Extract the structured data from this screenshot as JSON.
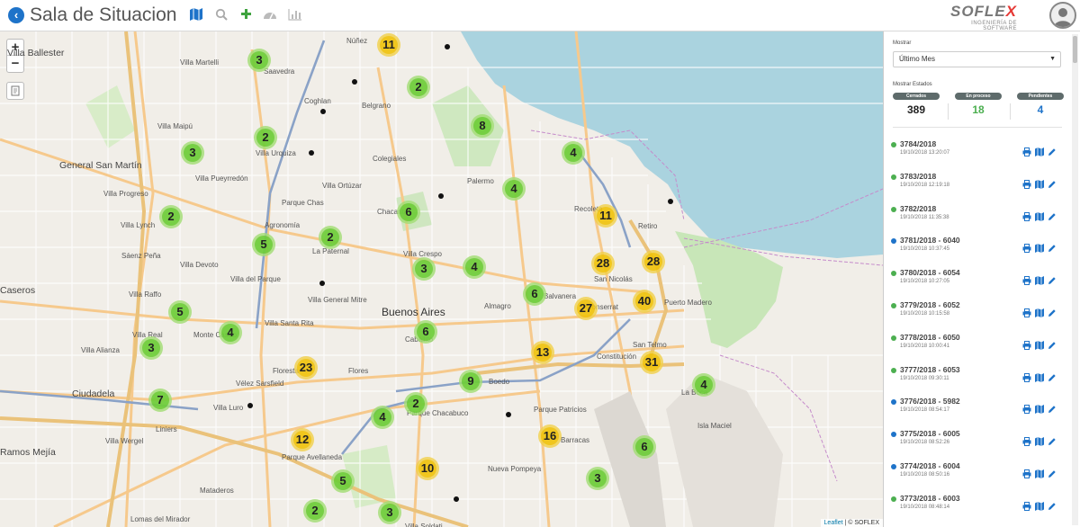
{
  "header": {
    "title": "Sala de Situacion",
    "logo_brand": "SOFLE",
    "logo_brand_x": "X",
    "logo_tagline": "INGENIERÍA DE SOFTWARE"
  },
  "map": {
    "zoom_in": "+",
    "zoom_out": "−",
    "attribution_link": "Leaflet",
    "attribution_rest": " | © SOFLEX",
    "clusters": [
      {
        "n": "11",
        "color": "yellow"
      },
      {
        "n": "3",
        "color": "green"
      },
      {
        "n": "2",
        "color": "green"
      },
      {
        "n": "8",
        "color": "green"
      },
      {
        "n": "2",
        "color": "green"
      },
      {
        "n": "3",
        "color": "green"
      },
      {
        "n": "4",
        "color": "green"
      },
      {
        "n": "4",
        "color": "green"
      },
      {
        "n": "6",
        "color": "green"
      },
      {
        "n": "11",
        "color": "yellow"
      },
      {
        "n": "2",
        "color": "green"
      },
      {
        "n": "2",
        "color": "green"
      },
      {
        "n": "5",
        "color": "green"
      },
      {
        "n": "3",
        "color": "green"
      },
      {
        "n": "4",
        "color": "green"
      },
      {
        "n": "28",
        "color": "yellow"
      },
      {
        "n": "28",
        "color": "yellow"
      },
      {
        "n": "6",
        "color": "green"
      },
      {
        "n": "40",
        "color": "yellow"
      },
      {
        "n": "27",
        "color": "yellow"
      },
      {
        "n": "5",
        "color": "green"
      },
      {
        "n": "4",
        "color": "green"
      },
      {
        "n": "3",
        "color": "green"
      },
      {
        "n": "6",
        "color": "green"
      },
      {
        "n": "13",
        "color": "yellow"
      },
      {
        "n": "23",
        "color": "yellow"
      },
      {
        "n": "31",
        "color": "yellow"
      },
      {
        "n": "9",
        "color": "green"
      },
      {
        "n": "4",
        "color": "green"
      },
      {
        "n": "7",
        "color": "green"
      },
      {
        "n": "2",
        "color": "green"
      },
      {
        "n": "4",
        "color": "green"
      },
      {
        "n": "16",
        "color": "yellow"
      },
      {
        "n": "12",
        "color": "yellow"
      },
      {
        "n": "6",
        "color": "green"
      },
      {
        "n": "10",
        "color": "yellow"
      },
      {
        "n": "5",
        "color": "green"
      },
      {
        "n": "3",
        "color": "green"
      },
      {
        "n": "2",
        "color": "green"
      },
      {
        "n": "3",
        "color": "green"
      }
    ],
    "place_labels": [
      "Villa Ballester",
      "Villa Martelli",
      "Saavedra",
      "Coghlan",
      "Belgrano",
      "Núñez",
      "Villa Maipú",
      "General San Martín",
      "Villa Urquiza",
      "Villa Pueyrredón",
      "Colegiales",
      "Palermo",
      "Villa Ortúzar",
      "Villa Progreso",
      "Villa Lynch",
      "Parque Chas",
      "Chacarita",
      "Recoleta",
      "Agronomía",
      "Retiro",
      "La Paternal",
      "Villa Crespo",
      "Villa Devoto",
      "Caseros",
      "Villa del Parque",
      "San Nicolás",
      "Villa Raffo",
      "Villa General Mitre",
      "Almagro",
      "Balvanera",
      "Monserrat",
      "Puerto Madero",
      "Buenos Aires",
      "Villa Santa Rita",
      "Villa Real",
      "Monte Castro",
      "Villa Alianza",
      "Caballito",
      "San Telmo",
      "Constitución",
      "Floresta",
      "Flores",
      "Vélez Sarsfield",
      "Ciudadela",
      "Boedo",
      "La Boca",
      "Villa Luro",
      "Parque Chacabuco",
      "Parque Patricios",
      "Isla Maciel",
      "Liniers",
      "Villa Wergel",
      "Barracas",
      "Ramos Mejía",
      "Parque Avellaneda",
      "Nueva Pompeya",
      "Mataderos",
      "Villa Soldati",
      "Lomas del Mirador",
      "Sáenz Peña"
    ]
  },
  "panel": {
    "mostrar_label": "Mostrar",
    "select_value": "Último Mes",
    "estados_label": "Mostrar Estados",
    "stats": [
      {
        "label": "Cerrados",
        "value": "389",
        "color": "#222222"
      },
      {
        "label": "En proceso",
        "value": "18",
        "color": "#4caf50"
      },
      {
        "label": "Pendientes",
        "value": "4",
        "color": "#1e73c9"
      }
    ],
    "items": [
      {
        "code": "3784/2018",
        "ts": "19/10/2018 13:20:07",
        "status": "#4caf50"
      },
      {
        "code": "3783/2018",
        "ts": "19/10/2018 12:19:18",
        "status": "#4caf50"
      },
      {
        "code": "3782/2018",
        "ts": "19/10/2018 11:35:38",
        "status": "#4caf50"
      },
      {
        "code": "3781/2018 - 6040",
        "ts": "19/10/2018 10:37:45",
        "status": "#1e73c9"
      },
      {
        "code": "3780/2018 - 6054",
        "ts": "19/10/2018 10:27:05",
        "status": "#4caf50"
      },
      {
        "code": "3779/2018 - 6052",
        "ts": "19/10/2018 10:15:58",
        "status": "#4caf50"
      },
      {
        "code": "3778/2018 - 6050",
        "ts": "19/10/2018 10:00:41",
        "status": "#4caf50"
      },
      {
        "code": "3777/2018 - 6053",
        "ts": "19/10/2018 09:30:11",
        "status": "#4caf50"
      },
      {
        "code": "3776/2018 - 5982",
        "ts": "19/10/2018 08:54:17",
        "status": "#1e73c9"
      },
      {
        "code": "3775/2018 - 6005",
        "ts": "19/10/2018 08:52:26",
        "status": "#1e73c9"
      },
      {
        "code": "3774/2018 - 6004",
        "ts": "19/10/2018 08:50:16",
        "status": "#1e73c9"
      },
      {
        "code": "3773/2018 - 6003",
        "ts": "19/10/2018 08:48:14",
        "status": "#4caf50"
      }
    ]
  }
}
